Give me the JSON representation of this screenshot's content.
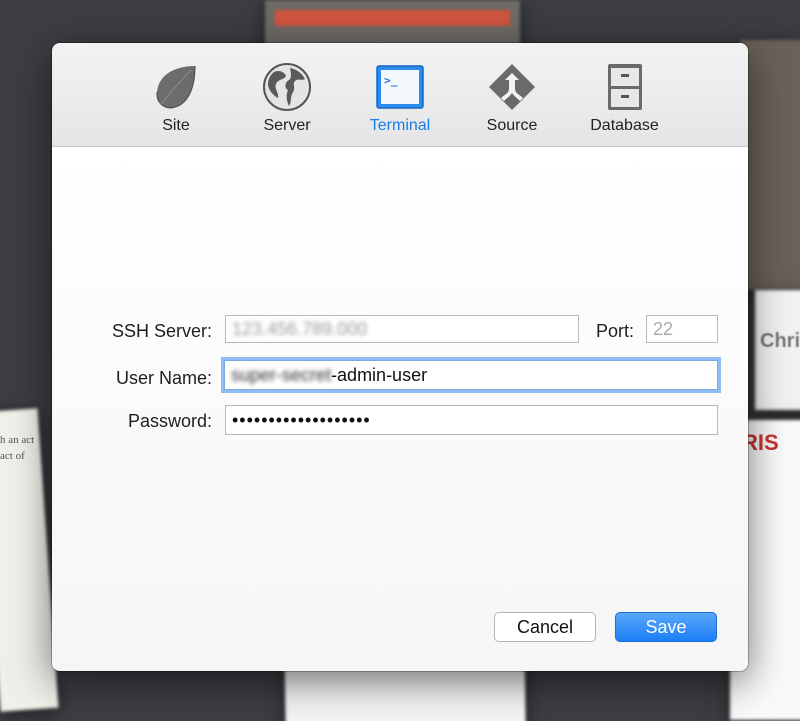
{
  "tabs": [
    {
      "key": "site",
      "label": "Site",
      "icon": "leaf-icon"
    },
    {
      "key": "server",
      "label": "Server",
      "icon": "globe-icon"
    },
    {
      "key": "terminal",
      "label": "Terminal",
      "icon": "terminal-icon",
      "selected": true
    },
    {
      "key": "source",
      "label": "Source",
      "icon": "source-control-icon"
    },
    {
      "key": "database",
      "label": "Database",
      "icon": "file-cabinet-icon"
    }
  ],
  "form": {
    "ssh_server_label": "SSH Server:",
    "ssh_server_value": "123.456.789.000",
    "port_label": "Port:",
    "port_placeholder": "22",
    "user_name_label": "User Name:",
    "user_name_value_obscured": "super-secret",
    "user_name_value_visible": "-admin-user",
    "password_label": "Password:",
    "password_value": "•••••••••••••••••••"
  },
  "buttons": {
    "cancel": "Cancel",
    "save": "Save"
  },
  "background": {
    "right_text": "Chri",
    "right_doc_title": "RIS",
    "left_text_1": "h an act",
    "left_text_2": "act of"
  },
  "colors": {
    "accent": "#1a7ee6",
    "save_button": "#2a88f7",
    "focus_ring": "#8fbdf3"
  }
}
